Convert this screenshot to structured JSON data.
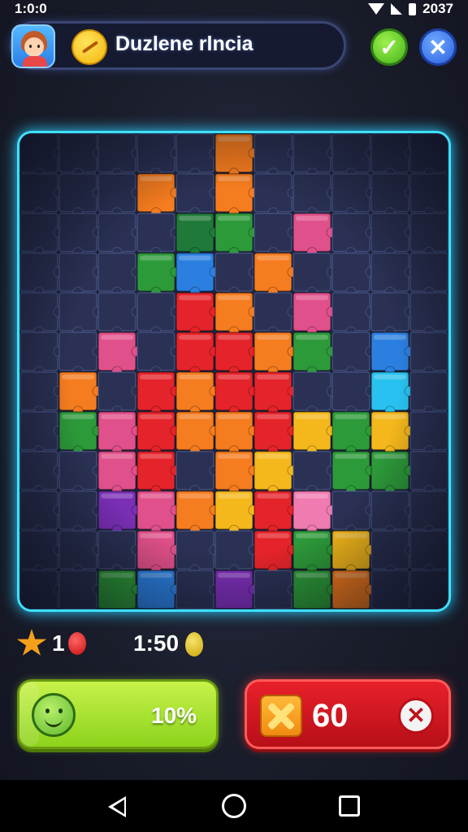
{
  "status_bar": {
    "time": "1:0:0",
    "battery_text": "2037"
  },
  "header": {
    "title": "Duzlene rlncia"
  },
  "stats": {
    "lives": "1",
    "time": "1:50"
  },
  "buttons": {
    "progress_label": "10%",
    "progress": 0.1,
    "score_value": "60"
  },
  "icons": {
    "avatar": "avatar-icon",
    "coin": "coin-icon",
    "confirm": "check-icon",
    "close": "close-icon",
    "star": "star-icon",
    "heart": "heart-icon",
    "egg": "egg-icon",
    "smiley": "smiley-icon",
    "x_box": "x-box-icon",
    "cancel": "cancel-icon"
  },
  "colors": {
    "frame_glow": "#3fe0ff",
    "progress_button": "#9edc2a",
    "score_button": "#d8161f",
    "empty_slot": "#2a3154"
  },
  "puzzle": {
    "rows": 12,
    "cols": 11,
    "cells": [
      ".....O.....",
      "...O.O.....",
      "....DG.P...",
      "...GB.O....",
      "....RO.P...",
      "..P.RROG.B.",
      ".O.RORR..C.",
      ".GPROORYGY.",
      "..PR.OY.GG.",
      "..VPOYRK...",
      "...P..RGY..",
      "..GB.V.GO.."
    ],
    "legend": {
      "R": "#e4242a",
      "O": "#f57c1f",
      "Y": "#f5b81c",
      "G": "#2d9a3a",
      "D": "#1f7a3a",
      "B": "#2b7fe0",
      "C": "#29c1ef",
      "P": "#e0508a",
      "K": "#f07bb0",
      "V": "#7a2fb5"
    }
  }
}
